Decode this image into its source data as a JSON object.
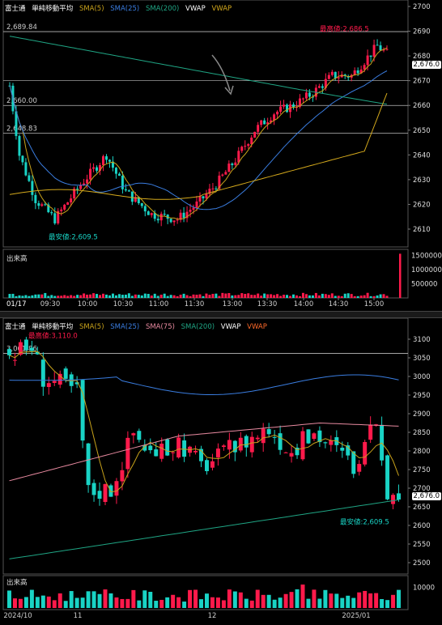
{
  "top": {
    "legend": {
      "symbol": "富士通",
      "label": "単純移動平均",
      "sma5": "SMA(5)",
      "sma25": "SMA(25)",
      "sma200": "SMA(200)",
      "vwap1": "VWAP",
      "vwap2": "VWAP"
    },
    "y_ticks": [
      "2700",
      "2690",
      "2680",
      "2670",
      "2660",
      "2650",
      "2640",
      "2630",
      "2620",
      "2610"
    ],
    "current_price": "2,676.0",
    "h_lines": [
      "2,689.84",
      "2,660.00",
      "2,648.83"
    ],
    "high_label": "最高値:2,686.5",
    "low_label": "最安値:2,609.5",
    "volume_label": "出来高",
    "volume_ticks": [
      "1500000",
      "1000000",
      "500000"
    ],
    "x_date": "01/17",
    "x_ticks": [
      "09:30",
      "10:00",
      "10:30",
      "11:00",
      "11:30",
      "13:00",
      "13:30",
      "14:00",
      "14:30",
      "15:00"
    ]
  },
  "bottom": {
    "legend": {
      "symbol": "富士通",
      "label": "単純移動平均",
      "sma5": "SMA(5)",
      "sma25": "SMA(25)",
      "sma75": "SMA(75)",
      "sma200": "SMA(200)",
      "vwap1": "VWAP",
      "vwap2": "VWAP"
    },
    "y_ticks": [
      "3100",
      "3050",
      "3000",
      "2950",
      "2900",
      "2850",
      "2800",
      "2750",
      "2700",
      "2650",
      "2600",
      "2550",
      "2500"
    ],
    "current_price": "2,676.0",
    "h_line": "3,061.86",
    "high_label": "最高値:3,110.0",
    "low_label": "最安値:2,609.5",
    "volume_label": "出来高",
    "volume_ticks": [
      "10000"
    ],
    "x_ticks": [
      "2024/10",
      "11",
      "12",
      "2025/01"
    ]
  },
  "colors": {
    "up": "#ff1a4b",
    "down": "#19d3c5",
    "sma5": "#c8a21b",
    "sma25": "#3a7de0",
    "sma75": "#e88aa0",
    "sma200": "#1fa584",
    "vwap": "#ffffff",
    "vwap2": "#d4a91c"
  }
}
